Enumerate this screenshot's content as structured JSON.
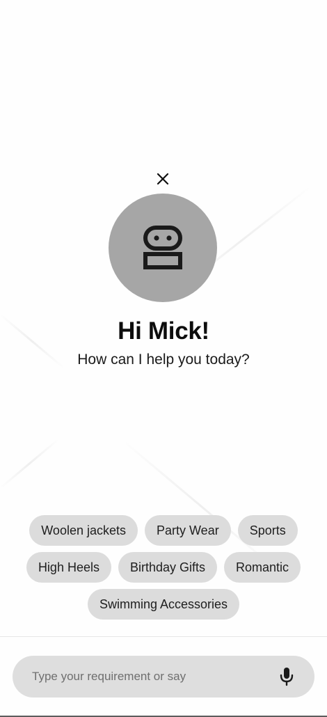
{
  "close": {
    "icon": "close-icon"
  },
  "avatar": {
    "icon": "robot-icon",
    "background": "#a6a6a6"
  },
  "greeting": "Hi Mick!",
  "subtitle": "How can I help you today?",
  "suggestions": {
    "row1": [
      "Woolen jackets",
      "Party Wear",
      "Sports"
    ],
    "row2": [
      "High Heels",
      "Birthday Gifts",
      "Romantic"
    ],
    "row3": [
      "Swimming Accessories"
    ]
  },
  "input": {
    "placeholder": "Type your requirement or say",
    "value": "",
    "mic_icon": "microphone-icon"
  },
  "colors": {
    "chip_bg": "#dcdcdc",
    "input_bg": "#dedede",
    "text": "#111111"
  }
}
